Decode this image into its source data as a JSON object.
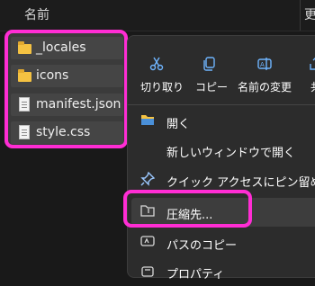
{
  "header": {
    "column_name": "名前",
    "column_next": "更"
  },
  "files": [
    {
      "name": "_locales",
      "icon": "folder-icon"
    },
    {
      "name": "icons",
      "icon": "folder-icon"
    },
    {
      "name": "manifest.json",
      "icon": "document-icon"
    },
    {
      "name": "style.css",
      "icon": "document-icon"
    }
  ],
  "menu": {
    "quick_actions": [
      {
        "label": "切り取り",
        "icon": "scissors-icon"
      },
      {
        "label": "コピー",
        "icon": "copy-icon"
      },
      {
        "label": "名前の変更",
        "icon": "rename-icon"
      },
      {
        "label": "共",
        "icon": "share-icon"
      }
    ],
    "items": [
      {
        "label": "開く",
        "icon": "folder-open-icon"
      },
      {
        "label": "新しいウィンドウで開く",
        "icon": "open-new-window-icon"
      },
      {
        "label": "クイック アクセスにピン留めす",
        "icon": "pin-icon"
      },
      {
        "label": "圧縮先...",
        "icon": "zip-folder-icon"
      },
      {
        "label": "パスのコピー",
        "icon": "copy-path-icon"
      },
      {
        "label": "プロパティ",
        "icon": "properties-icon"
      }
    ]
  },
  "colors": {
    "highlight": "#ff2dd4",
    "accent": "#6fb5ff",
    "folder": "#f5c242"
  }
}
